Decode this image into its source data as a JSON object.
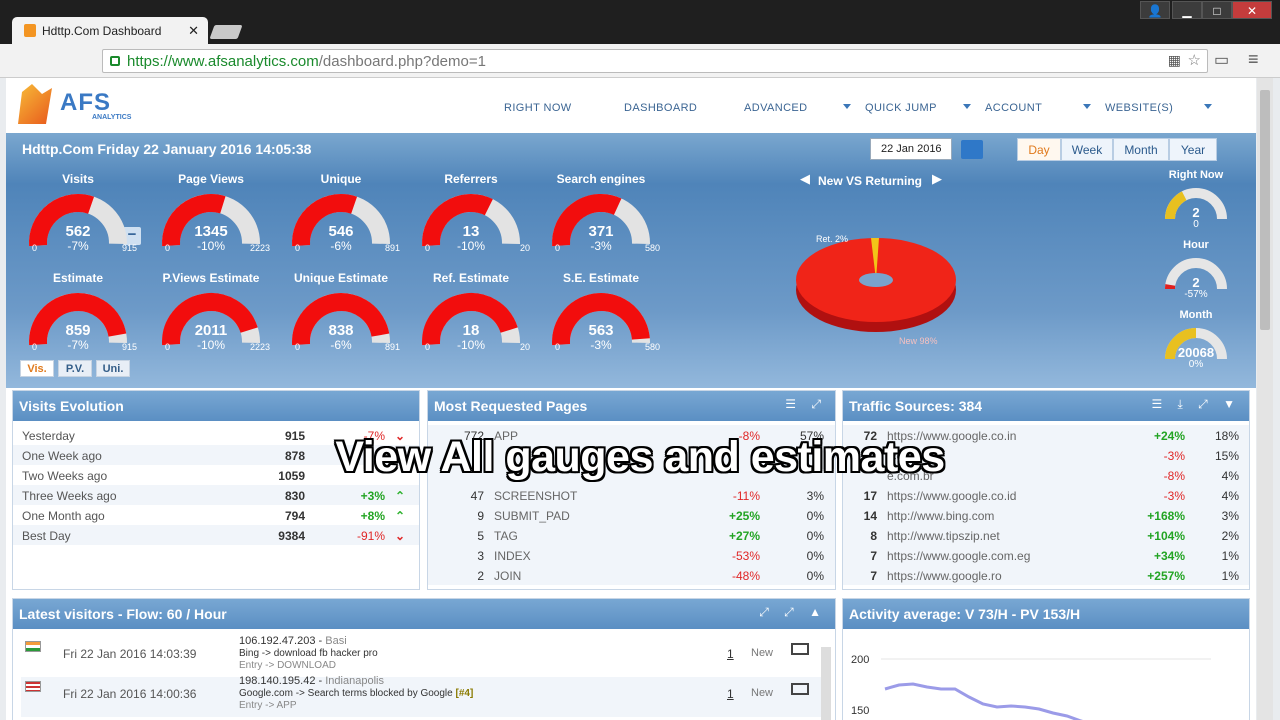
{
  "browser": {
    "tab_title": "Hdttp.Com Dashboard",
    "url_host": "https://www.afsanalytics.com",
    "url_path": "/dashboard.php?demo=1"
  },
  "logo": {
    "name": "AFS",
    "sub": "ANALYTICS"
  },
  "menu": [
    "RIGHT NOW",
    "DASHBOARD",
    "ADVANCED",
    "QUICK JUMP",
    "ACCOUNT",
    "WEBSITE(S)"
  ],
  "header": {
    "title": "Hdttp.Com Friday 22 January 2016 14:05:38",
    "date": "22 Jan 2016",
    "periods": [
      "Day",
      "Week",
      "Month",
      "Year"
    ],
    "active_period": "Day"
  },
  "gauges_top": [
    {
      "label": "Visits",
      "value": "562",
      "pct": "-7%",
      "min": "0",
      "max": "915",
      "fill": 0.61
    },
    {
      "label": "Page Views",
      "value": "1345",
      "pct": "-10%",
      "min": "0",
      "max": "2223",
      "fill": 0.6
    },
    {
      "label": "Unique",
      "value": "546",
      "pct": "-6%",
      "min": "0",
      "max": "891",
      "fill": 0.61
    },
    {
      "label": "Referrers",
      "value": "13",
      "pct": "-10%",
      "min": "0",
      "max": "20",
      "fill": 0.65
    },
    {
      "label": "Search engines",
      "value": "371",
      "pct": "-3%",
      "min": "0",
      "max": "580",
      "fill": 0.64
    }
  ],
  "gauges_est": [
    {
      "label": "Estimate",
      "value": "859",
      "pct": "-7%",
      "min": "0",
      "max": "915",
      "fill": 0.94
    },
    {
      "label": "P.Views Estimate",
      "value": "2011",
      "pct": "-10%",
      "min": "0",
      "max": "2223",
      "fill": 0.9
    },
    {
      "label": "Unique Estimate",
      "value": "838",
      "pct": "-6%",
      "min": "0",
      "max": "891",
      "fill": 0.94
    },
    {
      "label": "Ref. Estimate",
      "value": "18",
      "pct": "-10%",
      "min": "0",
      "max": "20",
      "fill": 0.9
    },
    {
      "label": "S.E. Estimate",
      "value": "563",
      "pct": "-3%",
      "min": "0",
      "max": "580",
      "fill": 0.97
    }
  ],
  "view_tabs": [
    "Vis.",
    "P.V.",
    "Uni."
  ],
  "pie": {
    "title": "New VS Returning",
    "returning_label": "Ret. 2%",
    "new_label": "New 98%",
    "returning": 2,
    "new": 98
  },
  "side_gauges": [
    {
      "label": "Right Now",
      "value": "2",
      "sub": "0",
      "fill": 0.35,
      "color": "#e8c020"
    },
    {
      "label": "Hour",
      "value": "2",
      "sub": "-57%",
      "fill": 0.05,
      "color": "#e02020"
    },
    {
      "label": "Month",
      "value": "20068",
      "sub": "0%",
      "fill": 0.5,
      "color": "#e8c020"
    }
  ],
  "visits_evolution": {
    "title": "Visits Evolution",
    "rows": [
      {
        "label": "Yesterday",
        "value": "915",
        "pct": "-7%",
        "dir": "d"
      },
      {
        "label": "One Week ago",
        "value": "878",
        "pct": "",
        "dir": ""
      },
      {
        "label": "Two Weeks ago",
        "value": "1059",
        "pct": "",
        "dir": ""
      },
      {
        "label": "Three Weeks ago",
        "value": "830",
        "pct": "+3%",
        "dir": "u"
      },
      {
        "label": "One Month ago",
        "value": "794",
        "pct": "+8%",
        "dir": "u"
      },
      {
        "label": "Best Day",
        "value": "9384",
        "pct": "-91%",
        "dir": "d"
      }
    ]
  },
  "requested_pages": {
    "title": "Most Requested Pages",
    "rows": [
      {
        "n": "772",
        "page": "APP",
        "pct": "-8%",
        "share": "57%"
      },
      {
        "n": "",
        "page": "",
        "pct": "",
        "share": ""
      },
      {
        "n": "",
        "page": "",
        "pct": "",
        "share": ""
      },
      {
        "n": "47",
        "page": "SCREENSHOT",
        "pct": "-11%",
        "share": "3%"
      },
      {
        "n": "9",
        "page": "SUBMIT_PAD",
        "pct": "+25%",
        "share": "0%"
      },
      {
        "n": "5",
        "page": "TAG",
        "pct": "+27%",
        "share": "0%"
      },
      {
        "n": "3",
        "page": "INDEX",
        "pct": "-53%",
        "share": "0%"
      },
      {
        "n": "2",
        "page": "JOIN",
        "pct": "-48%",
        "share": "0%"
      }
    ]
  },
  "traffic_sources": {
    "title": "Traffic Sources: 384",
    "rows": [
      {
        "n": "72",
        "src": "https://www.google.co.in",
        "pct": "+24%",
        "share": "18%"
      },
      {
        "n": "",
        "src": ".com",
        "pct": "-3%",
        "share": "15%"
      },
      {
        "n": "",
        "src": "e.com.br",
        "pct": "-8%",
        "share": "4%"
      },
      {
        "n": "17",
        "src": "https://www.google.co.id",
        "pct": "-3%",
        "share": "4%"
      },
      {
        "n": "14",
        "src": "http://www.bing.com",
        "pct": "+168%",
        "share": "3%"
      },
      {
        "n": "8",
        "src": "http://www.tipszip.net",
        "pct": "+104%",
        "share": "2%"
      },
      {
        "n": "7",
        "src": "https://www.google.com.eg",
        "pct": "+34%",
        "share": "1%"
      },
      {
        "n": "7",
        "src": "https://www.google.ro",
        "pct": "+257%",
        "share": "1%"
      }
    ]
  },
  "latest": {
    "title": "Latest visitors - Flow: 60 / Hour",
    "rows": [
      {
        "date": "Fri 22 Jan 2016 14:03:39",
        "ip": "106.192.47.203",
        "loc": "Basi",
        "ref": "Bing -> download fb hacker pro",
        "entry": "Entry -> DOWNLOAD",
        "count": "1",
        "type": "New"
      },
      {
        "date": "Fri 22 Jan 2016 14:00:36",
        "ip": "198.140.195.42",
        "loc": "Indianapolis",
        "ref": "Google.com -> Search terms blocked by Google",
        "tag": "[#4]",
        "entry": "Entry -> APP",
        "count": "1",
        "type": "New"
      }
    ]
  },
  "activity": {
    "title": "Activity average: V 73/H - PV 153/H",
    "y_labels": [
      "200",
      "150"
    ]
  },
  "caption": "View All gauges and estimates",
  "chart_data": {
    "type": "pie",
    "title": "New VS Returning",
    "categories": [
      "Ret.",
      "New"
    ],
    "values": [
      2,
      98
    ]
  }
}
